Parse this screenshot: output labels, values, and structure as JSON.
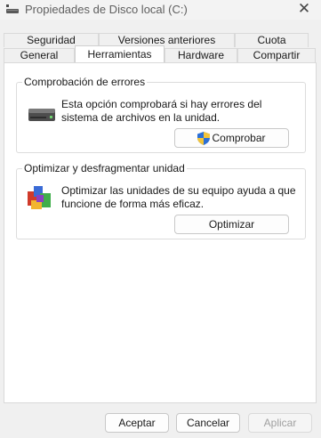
{
  "window": {
    "title": "Propiedades de Disco local (C:)"
  },
  "tabs": {
    "row1": [
      "Seguridad",
      "Versiones anteriores",
      "Cuota"
    ],
    "row2": [
      "General",
      "Herramientas",
      "Hardware",
      "Compartir"
    ],
    "active": "Herramientas"
  },
  "error_check": {
    "legend": "Comprobación de errores",
    "desc_line1": "Esta opción comprobará si hay errores del",
    "desc_line2": "sistema de archivos en la unidad.",
    "button": "Comprobar",
    "icon": "hard-drive-icon",
    "button_icon": "uac-shield-icon"
  },
  "optimize": {
    "legend": "Optimizar y desfragmentar unidad",
    "desc_line1": "Optimizar las unidades de su equipo ayuda a que",
    "desc_line2": "funcione de forma más eficaz.",
    "button": "Optimizar",
    "icon": "defrag-icon"
  },
  "footer": {
    "accept": "Aceptar",
    "cancel": "Cancelar",
    "apply": "Aplicar"
  },
  "colors": {
    "background": "#f0f0f0",
    "panel": "#ffffff",
    "disabled_text": "#a0a0a0"
  }
}
